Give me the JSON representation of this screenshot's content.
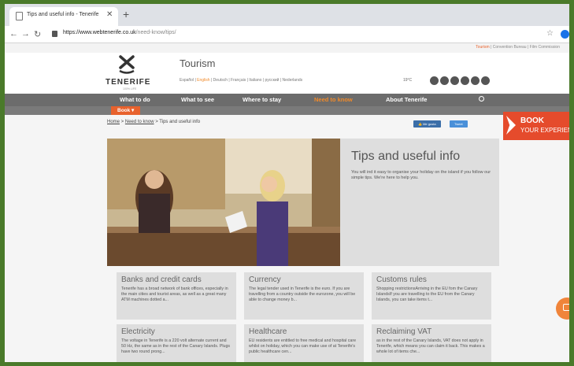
{
  "browser": {
    "tab_title": "Tips and useful info - Tenerife",
    "url_host": "https://www.webtenerife.co.uk",
    "url_path": "/need-know/tips/"
  },
  "top_links": {
    "active": "Tourism",
    "rest": "| Convention Bureau | Film Commission"
  },
  "header": {
    "logo_text": "TENERIFE",
    "logo_sub": "100% LIFE",
    "section_title": "Tourism",
    "languages": {
      "before": "Español |",
      "active": "English",
      "after": "| Deutsch | Français | Italiano | русский | Nederlands"
    },
    "weather": "19°C"
  },
  "main_nav": [
    "What to do",
    "What to see",
    "Where to stay",
    "Need to know",
    "About Tenerife"
  ],
  "book_now": "Book",
  "breadcrumb": {
    "home": "Home",
    "parent": "Need to know",
    "current": "Tips and useful info"
  },
  "share": {
    "like": "Me gusta",
    "tweet": "Tweet"
  },
  "side_book": {
    "line1": "BOOK",
    "line2": "YOUR EXPERIEN"
  },
  "hero": {
    "title": "Tips and useful info",
    "text": "You will ind it easy to organise your holiday on the island if you follow our simple tips. We're here to help you."
  },
  "cards": [
    {
      "title": "Banks and credit cards",
      "text": "Tenerife has a broad network of bank offices, especially in the main cities and tourist areas, as well as a great many ATM machines dotted a..."
    },
    {
      "title": "Currency",
      "text": "The legal tender used in Tenerife is the euro. If you are travelling from a country outside the eurozone, you will be able to change money b..."
    },
    {
      "title": "Customs rules",
      "text": "Shopping restrictionsArriving in the EU fom the Canary IslandsIf you are travelling to the EU from the Canary Islands, you can take items t..."
    },
    {
      "title": "Electricity",
      "text": "The voltage in Tenerife is a 220 volt alternate current and 50 Hz, the same as in the rest of the Canary Islands. Plugs have two round prong..."
    },
    {
      "title": "Healthcare",
      "text": "EU residents are entitled to free medical and hospital care whilst on holiday, which you can make use of at Tenerife's public healthcare cen..."
    },
    {
      "title": "Reclaiming VAT",
      "text": "as in the rest of the Canary Islands, VAT does not apply in Tenerife, which means you can claim it back. This makes a whole lot of items che..."
    }
  ]
}
